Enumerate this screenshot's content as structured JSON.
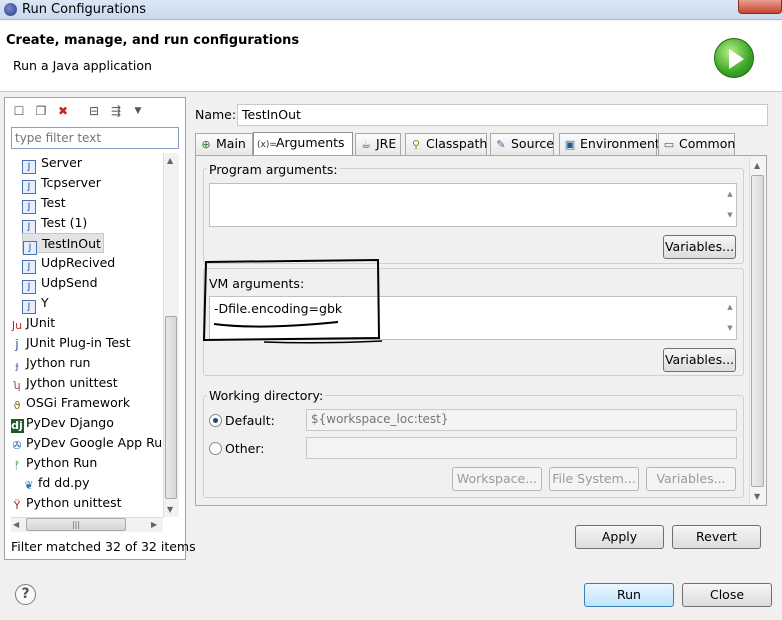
{
  "window": {
    "title": "Run Configurations"
  },
  "header": {
    "title": "Create, manage, and run configurations",
    "subtitle": "Run a Java application"
  },
  "left": {
    "filter_placeholder": "type filter text",
    "items": [
      {
        "label": "Server",
        "icon": "java-class-icon"
      },
      {
        "label": "Tcpserver",
        "icon": "java-class-icon"
      },
      {
        "label": "Test",
        "icon": "java-class-icon"
      },
      {
        "label": "Test (1)",
        "icon": "java-class-icon"
      },
      {
        "label": "TestInOut",
        "icon": "java-class-icon"
      },
      {
        "label": "UdpRecived",
        "icon": "java-class-icon"
      },
      {
        "label": "UdpSend",
        "icon": "java-class-icon"
      },
      {
        "label": "Y",
        "icon": "java-class-icon"
      },
      {
        "label": "JUnit",
        "icon": "junit-icon"
      },
      {
        "label": "JUnit Plug-in Test",
        "icon": "junit-plugin-icon"
      },
      {
        "label": "Jython run",
        "icon": "jython-icon"
      },
      {
        "label": "Jython unittest",
        "icon": "jython-unittest-icon"
      },
      {
        "label": "OSGi Framework",
        "icon": "osgi-icon"
      },
      {
        "label": "PyDev Django",
        "icon": "django-icon"
      },
      {
        "label": "PyDev Google App Run",
        "icon": "google-app-icon"
      },
      {
        "label": "Python Run",
        "icon": "python-run-icon"
      },
      {
        "label": "fd dd.py",
        "icon": "python-file-icon"
      },
      {
        "label": "Python unittest",
        "icon": "python-unittest-icon"
      }
    ],
    "status": "Filter matched 32 of 32 items"
  },
  "main": {
    "name_label": "Name:",
    "name_value": "TestInOut",
    "tabs": [
      {
        "label": "Main"
      },
      {
        "label": "Arguments"
      },
      {
        "label": "JRE"
      },
      {
        "label": "Classpath"
      },
      {
        "label": "Source"
      },
      {
        "label": "Environment"
      },
      {
        "label": "Common"
      }
    ],
    "program_args_label": "Program arguments:",
    "program_args_value": "",
    "vm_args_label": "VM arguments:",
    "vm_args_value": "-Dfile.encoding=gbk",
    "variables_label": "Variables...",
    "working_dir_label": "Working directory:",
    "default_label": "Default:",
    "default_value": "${workspace_loc:test}",
    "other_label": "Other:",
    "workspace_label": "Workspace...",
    "filesystem_label": "File System...",
    "variables2_label": "Variables...",
    "apply_label": "Apply",
    "revert_label": "Revert"
  },
  "footer": {
    "help": "?",
    "run_label": "Run",
    "close_label": "Close"
  }
}
